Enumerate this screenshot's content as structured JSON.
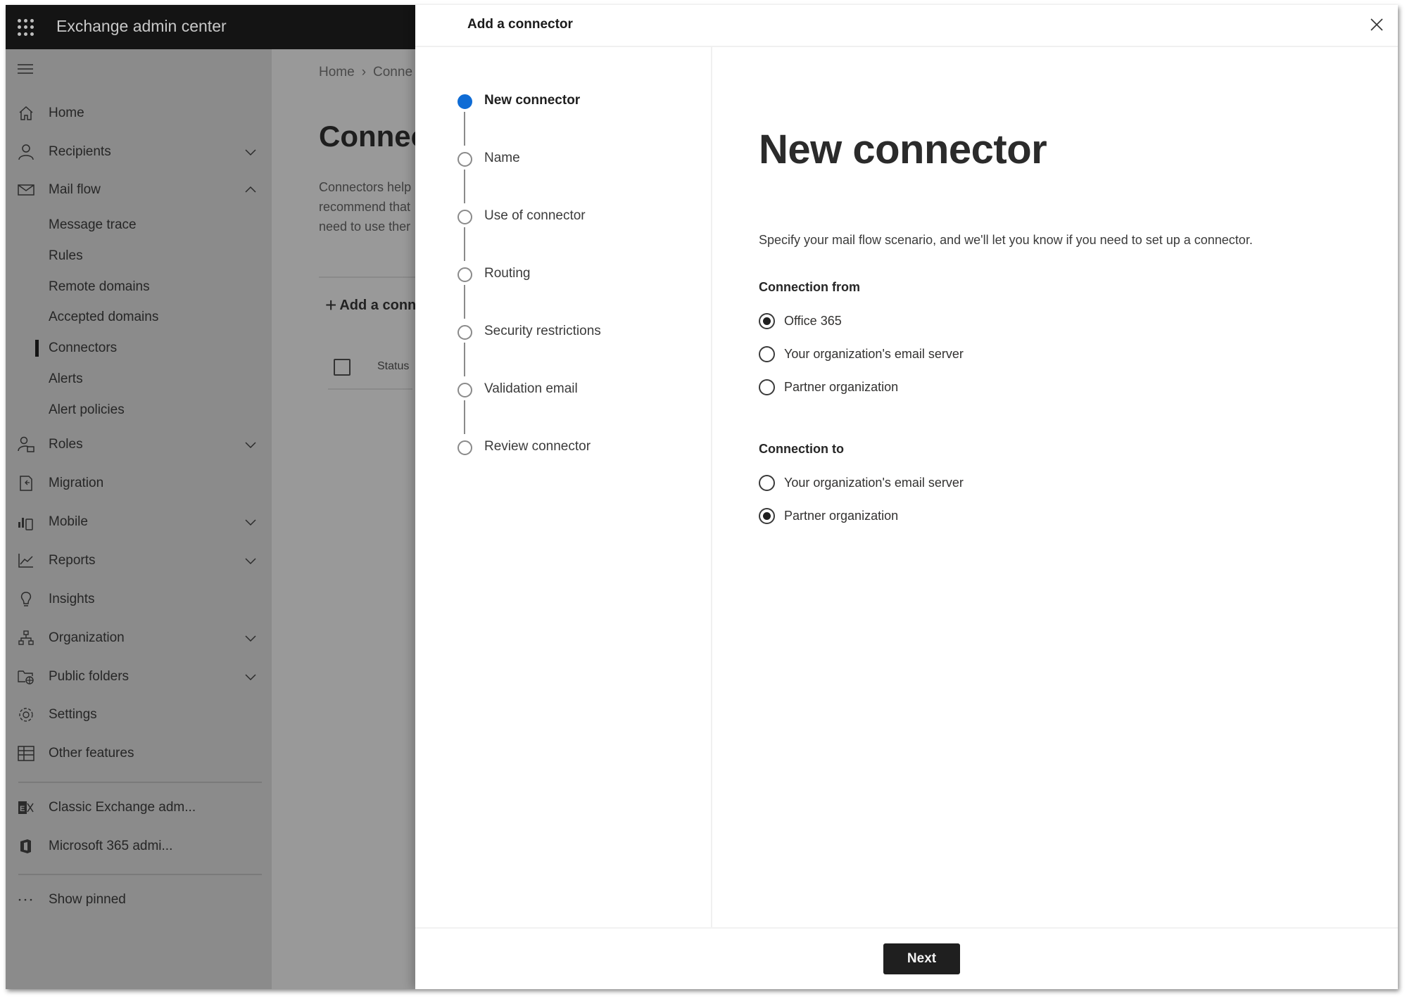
{
  "app": {
    "title": "Exchange admin center"
  },
  "sidebar": {
    "items": [
      {
        "label": "Home",
        "icon": "home-icon",
        "expandable": false
      },
      {
        "label": "Recipients",
        "icon": "person-icon",
        "expandable": true,
        "expanded": false
      },
      {
        "label": "Mail flow",
        "icon": "mail-icon",
        "expandable": true,
        "expanded": true
      },
      {
        "label": "Message trace",
        "sub": true
      },
      {
        "label": "Rules",
        "sub": true
      },
      {
        "label": "Remote domains",
        "sub": true
      },
      {
        "label": "Accepted domains",
        "sub": true
      },
      {
        "label": "Connectors",
        "sub": true,
        "active": true
      },
      {
        "label": "Alerts",
        "sub": true
      },
      {
        "label": "Alert policies",
        "sub": true
      },
      {
        "label": "Roles",
        "icon": "roles-icon",
        "expandable": true,
        "expanded": false
      },
      {
        "label": "Migration",
        "icon": "migration-icon",
        "expandable": false
      },
      {
        "label": "Mobile",
        "icon": "mobile-icon",
        "expandable": true,
        "expanded": false
      },
      {
        "label": "Reports",
        "icon": "reports-icon",
        "expandable": true,
        "expanded": false
      },
      {
        "label": "Insights",
        "icon": "lightbulb-icon",
        "expandable": false
      },
      {
        "label": "Organization",
        "icon": "organization-icon",
        "expandable": true,
        "expanded": false
      },
      {
        "label": "Public folders",
        "icon": "public-folder-icon",
        "expandable": true,
        "expanded": false
      },
      {
        "label": "Settings",
        "icon": "gear-icon",
        "expandable": false
      },
      {
        "label": "Other features",
        "icon": "table-icon",
        "expandable": false
      }
    ],
    "links": [
      {
        "label": "Classic Exchange adm...",
        "icon": "exchange-icon"
      },
      {
        "label": "Microsoft 365 admi...",
        "icon": "office-icon"
      }
    ],
    "show_pinned": "Show pinned"
  },
  "background_page": {
    "breadcrumb": [
      "Home",
      "Conne"
    ],
    "heading": "Connec",
    "description_lines": [
      "Connectors help",
      "recommend that",
      "need to use ther"
    ],
    "add_button": "Add a conn",
    "table_header_status": "Status"
  },
  "panel": {
    "title": "Add a connector",
    "steps": [
      {
        "label": "New connector",
        "active": true
      },
      {
        "label": "Name",
        "active": false
      },
      {
        "label": "Use of connector",
        "active": false
      },
      {
        "label": "Routing",
        "active": false
      },
      {
        "label": "Security restrictions",
        "active": false
      },
      {
        "label": "Validation email",
        "active": false
      },
      {
        "label": "Review connector",
        "active": false
      }
    ],
    "heading": "New connector",
    "description": "Specify your mail flow scenario, and we'll let you know if you need to set up a connector.",
    "connection_from": {
      "label": "Connection from",
      "options": [
        {
          "label": "Office 365",
          "selected": true
        },
        {
          "label": "Your organization's email server",
          "selected": false
        },
        {
          "label": "Partner organization",
          "selected": false
        }
      ]
    },
    "connection_to": {
      "label": "Connection to",
      "options": [
        {
          "label": "Your organization's email server",
          "selected": false
        },
        {
          "label": "Partner organization",
          "selected": true
        }
      ]
    },
    "next_label": "Next",
    "accent_color": "#0f6cd5"
  }
}
